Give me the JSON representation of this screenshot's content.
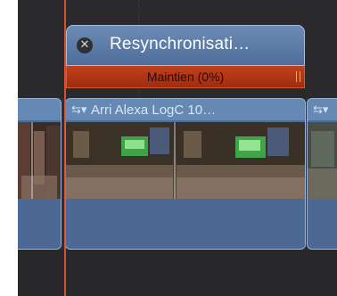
{
  "connected_clip": {
    "title": "Resynchronisati…",
    "close_glyph": "✕",
    "retime_label": "Maintien (0%)"
  },
  "primary_clip": {
    "title": "Arri Alexa LogC 10…",
    "title_icon": "clip-options-icon"
  },
  "colors": {
    "clip_blue": "#4d6c97",
    "retime_red": "#a6330f",
    "playhead": "#e4553a"
  }
}
